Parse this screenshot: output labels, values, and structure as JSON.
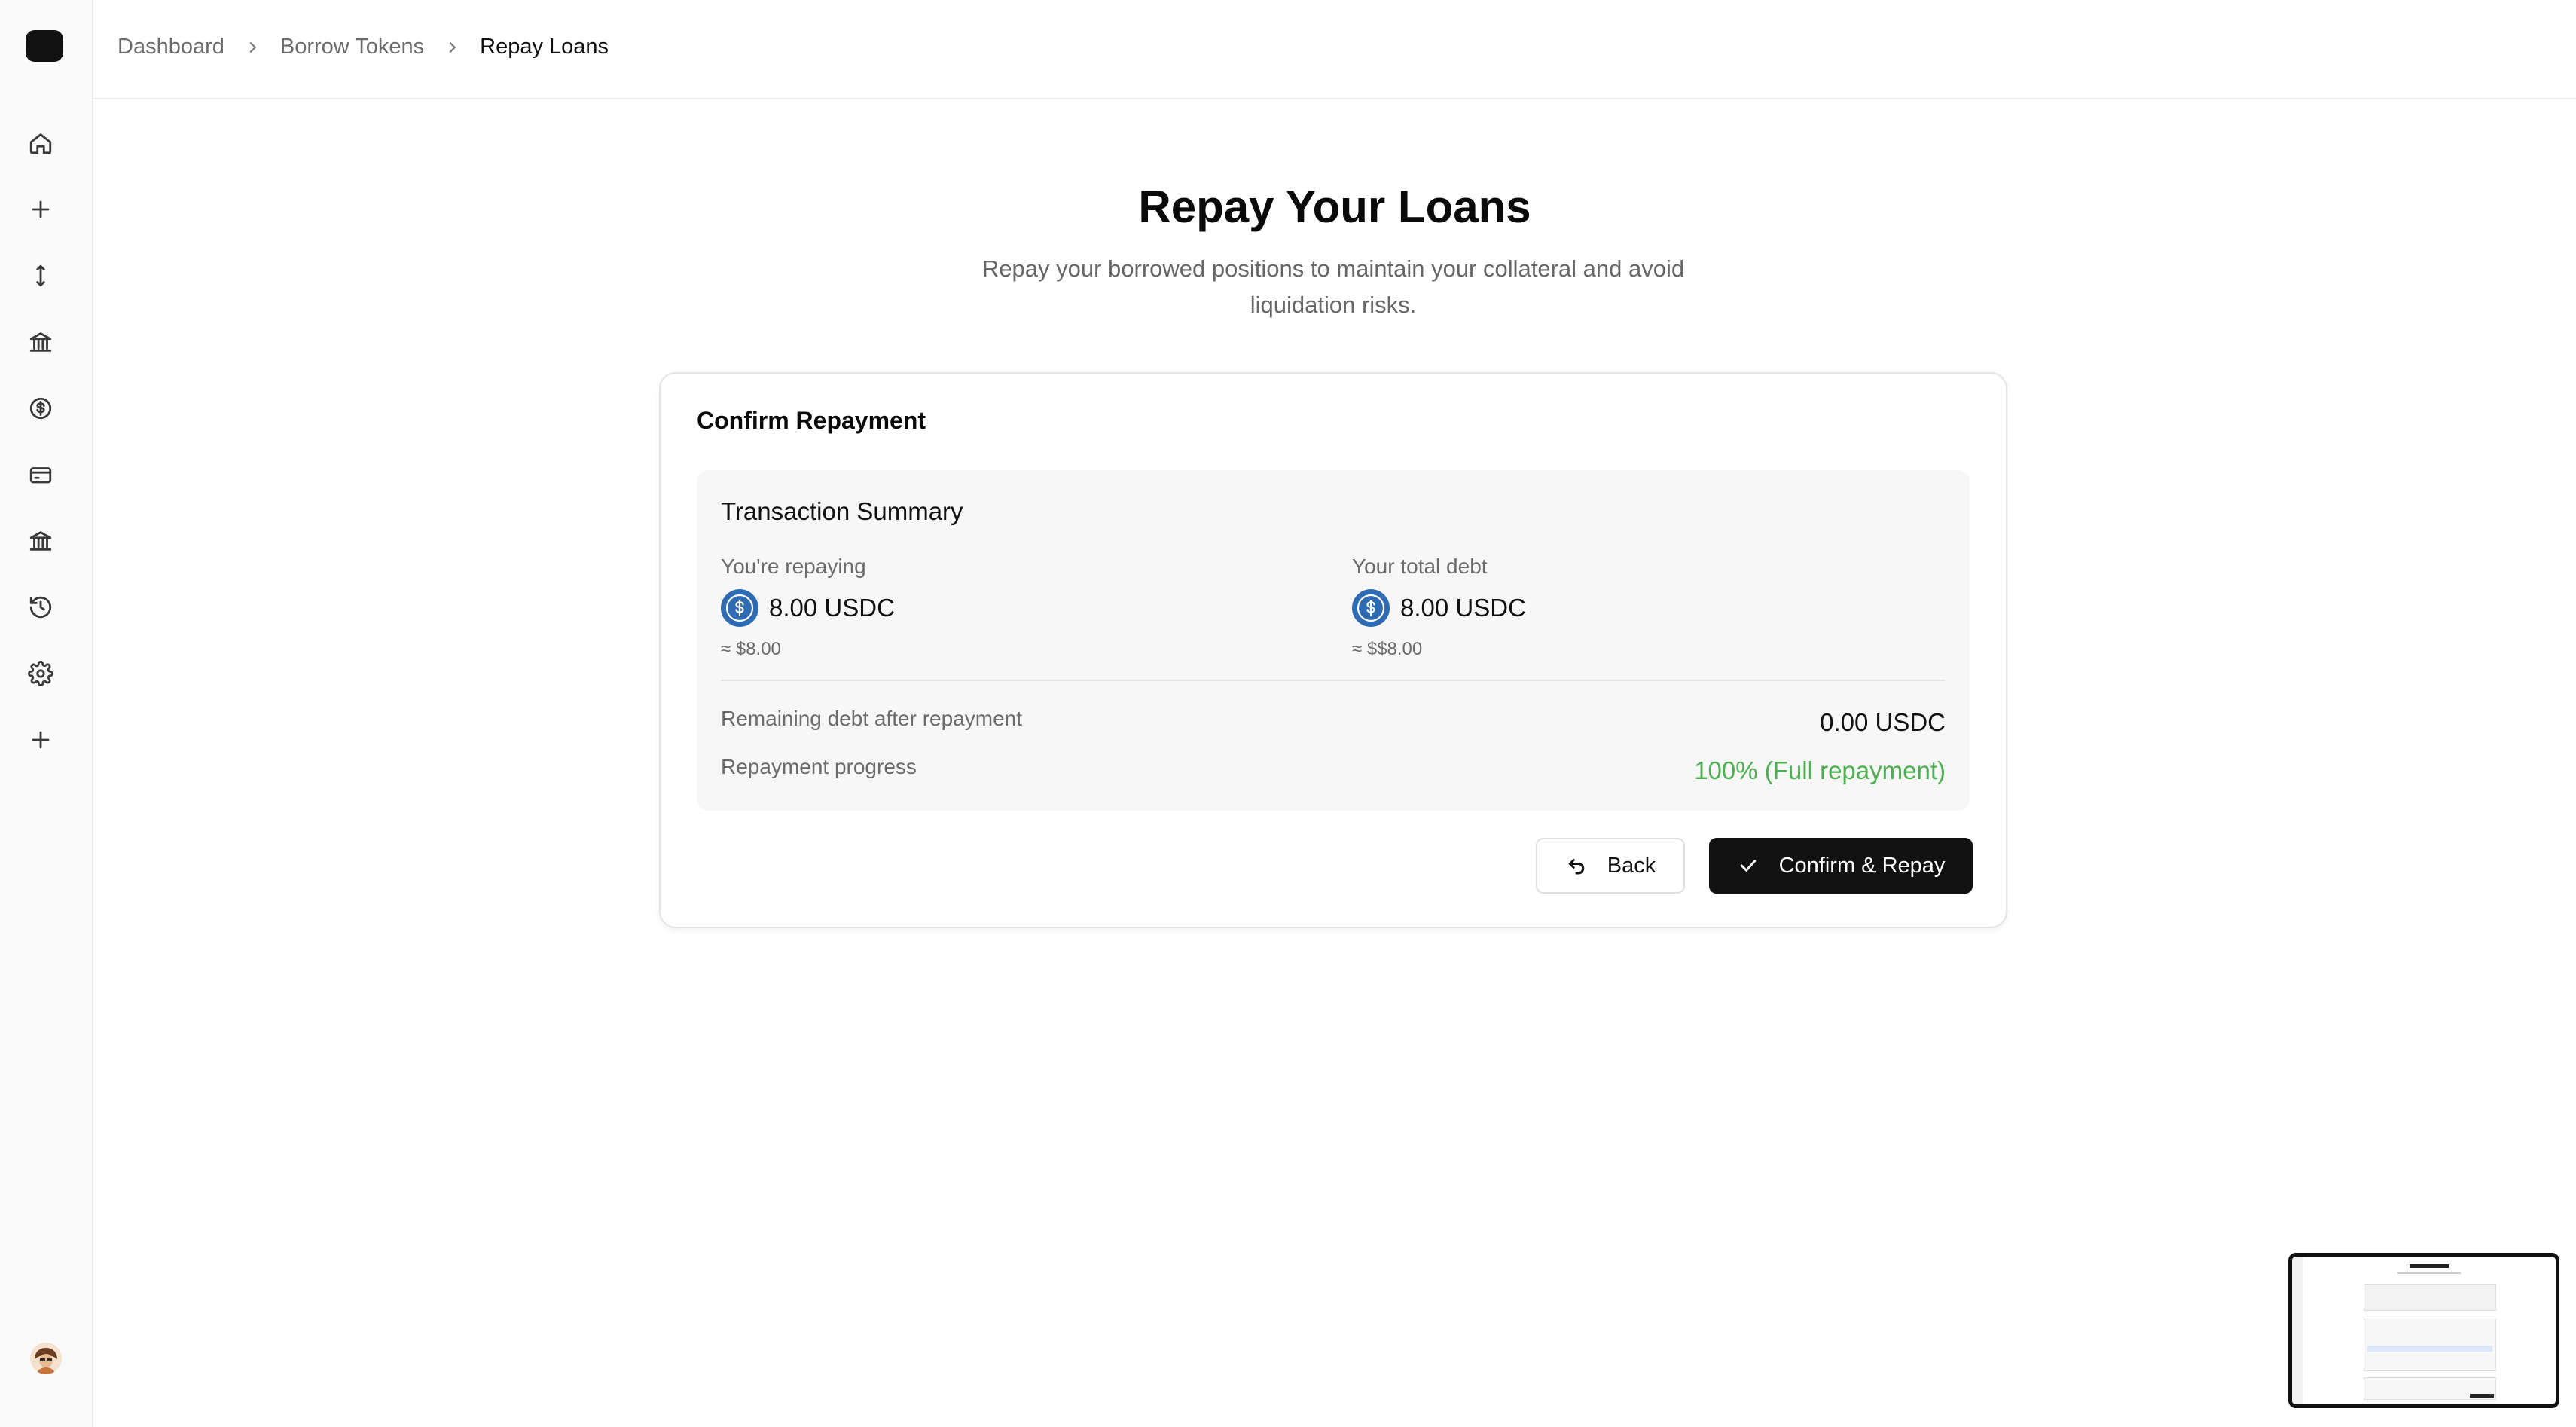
{
  "breadcrumb": {
    "items": [
      "Dashboard",
      "Borrow Tokens",
      "Repay Loans"
    ]
  },
  "sidebar": {
    "items": [
      {
        "icon": "home-icon"
      },
      {
        "icon": "plus-icon"
      },
      {
        "icon": "transfer-icon"
      },
      {
        "icon": "bank-icon"
      },
      {
        "icon": "dollar-circle-icon"
      },
      {
        "icon": "credit-card-icon"
      },
      {
        "icon": "bank-icon"
      },
      {
        "icon": "history-icon"
      },
      {
        "icon": "gear-icon"
      },
      {
        "icon": "plus-icon"
      }
    ]
  },
  "header": {
    "title": "Repay Your Loans",
    "subtitle": "Repay your borrowed positions to maintain your collateral and avoid liquidation risks."
  },
  "card": {
    "title": "Confirm Repayment",
    "summary": {
      "title": "Transaction Summary",
      "repaying": {
        "label": "You're repaying",
        "amount": "8.00 USDC",
        "approx": "≈ $8.00"
      },
      "total_debt": {
        "label": "Your total debt",
        "amount": "8.00 USDC",
        "approx": "≈ $$8.00"
      },
      "remaining": {
        "label": "Remaining debt after repayment",
        "value": "0.00 USDC"
      },
      "progress": {
        "label": "Repayment progress",
        "value": "100% (Full repayment)"
      }
    },
    "buttons": {
      "back": "Back",
      "confirm": "Confirm & Repay"
    }
  },
  "colors": {
    "accent_dark": "#111111",
    "success": "#4caf50",
    "usdc_blue": "#2f6bb3"
  }
}
